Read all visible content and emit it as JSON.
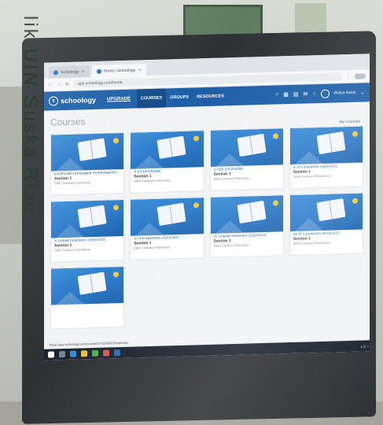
{
  "watermark": "lik UIN Suska Riau",
  "browser": {
    "tabs": [
      {
        "label": "Schoology"
      },
      {
        "label": "Home | Schoology"
      }
    ],
    "url": "app.schoology.com/home"
  },
  "header": {
    "logo": "schoology",
    "upgrade": "UPGRADE",
    "nav": [
      "COURSES",
      "GROUPS",
      "RESOURCES"
    ],
    "user": "Widya Astuti"
  },
  "page": {
    "title": "Courses",
    "my_courses_link": "My Courses"
  },
  "courses": [
    {
      "name": "EKONOMI (Perangkat Pembelajaran)",
      "section": "Section 1",
      "instructor": "SMK Cendana Pekanbaru"
    },
    {
      "name": "X IIS EKONOMI",
      "section": "Section 1",
      "instructor": "SMA Cendana Pekanbaru"
    },
    {
      "name": "LITBK EKONOMI",
      "section": "Section 1",
      "instructor": "SMA Cendana Pekanbaru"
    },
    {
      "name": "X IPS Ekonomi 2020/2021",
      "section": "Section 1",
      "instructor": "SMA Cendana Pekanbaru"
    },
    {
      "name": "X Lintasin Ekonomi 2020/2021",
      "section": "Section 1",
      "instructor": "SMA Cendana Pekanbaru"
    },
    {
      "name": "XI IPS Ekonomi 2020/2021",
      "section": "Section 1",
      "instructor": "SMA Cendana Pekanbaru"
    },
    {
      "name": "XI Lintasin Ekonomi 2020/2021",
      "section": "Section 1",
      "instructor": "SMA Cendana Pekanbaru"
    },
    {
      "name": "XII IPS Ekonomi 2020/2021",
      "section": "Section 1",
      "instructor": "SMA Cendana Pekanbaru"
    },
    {
      "name": "",
      "section": "",
      "instructor": ""
    }
  ],
  "statusbar": "https://app.schoology.com/course/2775246353/materials"
}
